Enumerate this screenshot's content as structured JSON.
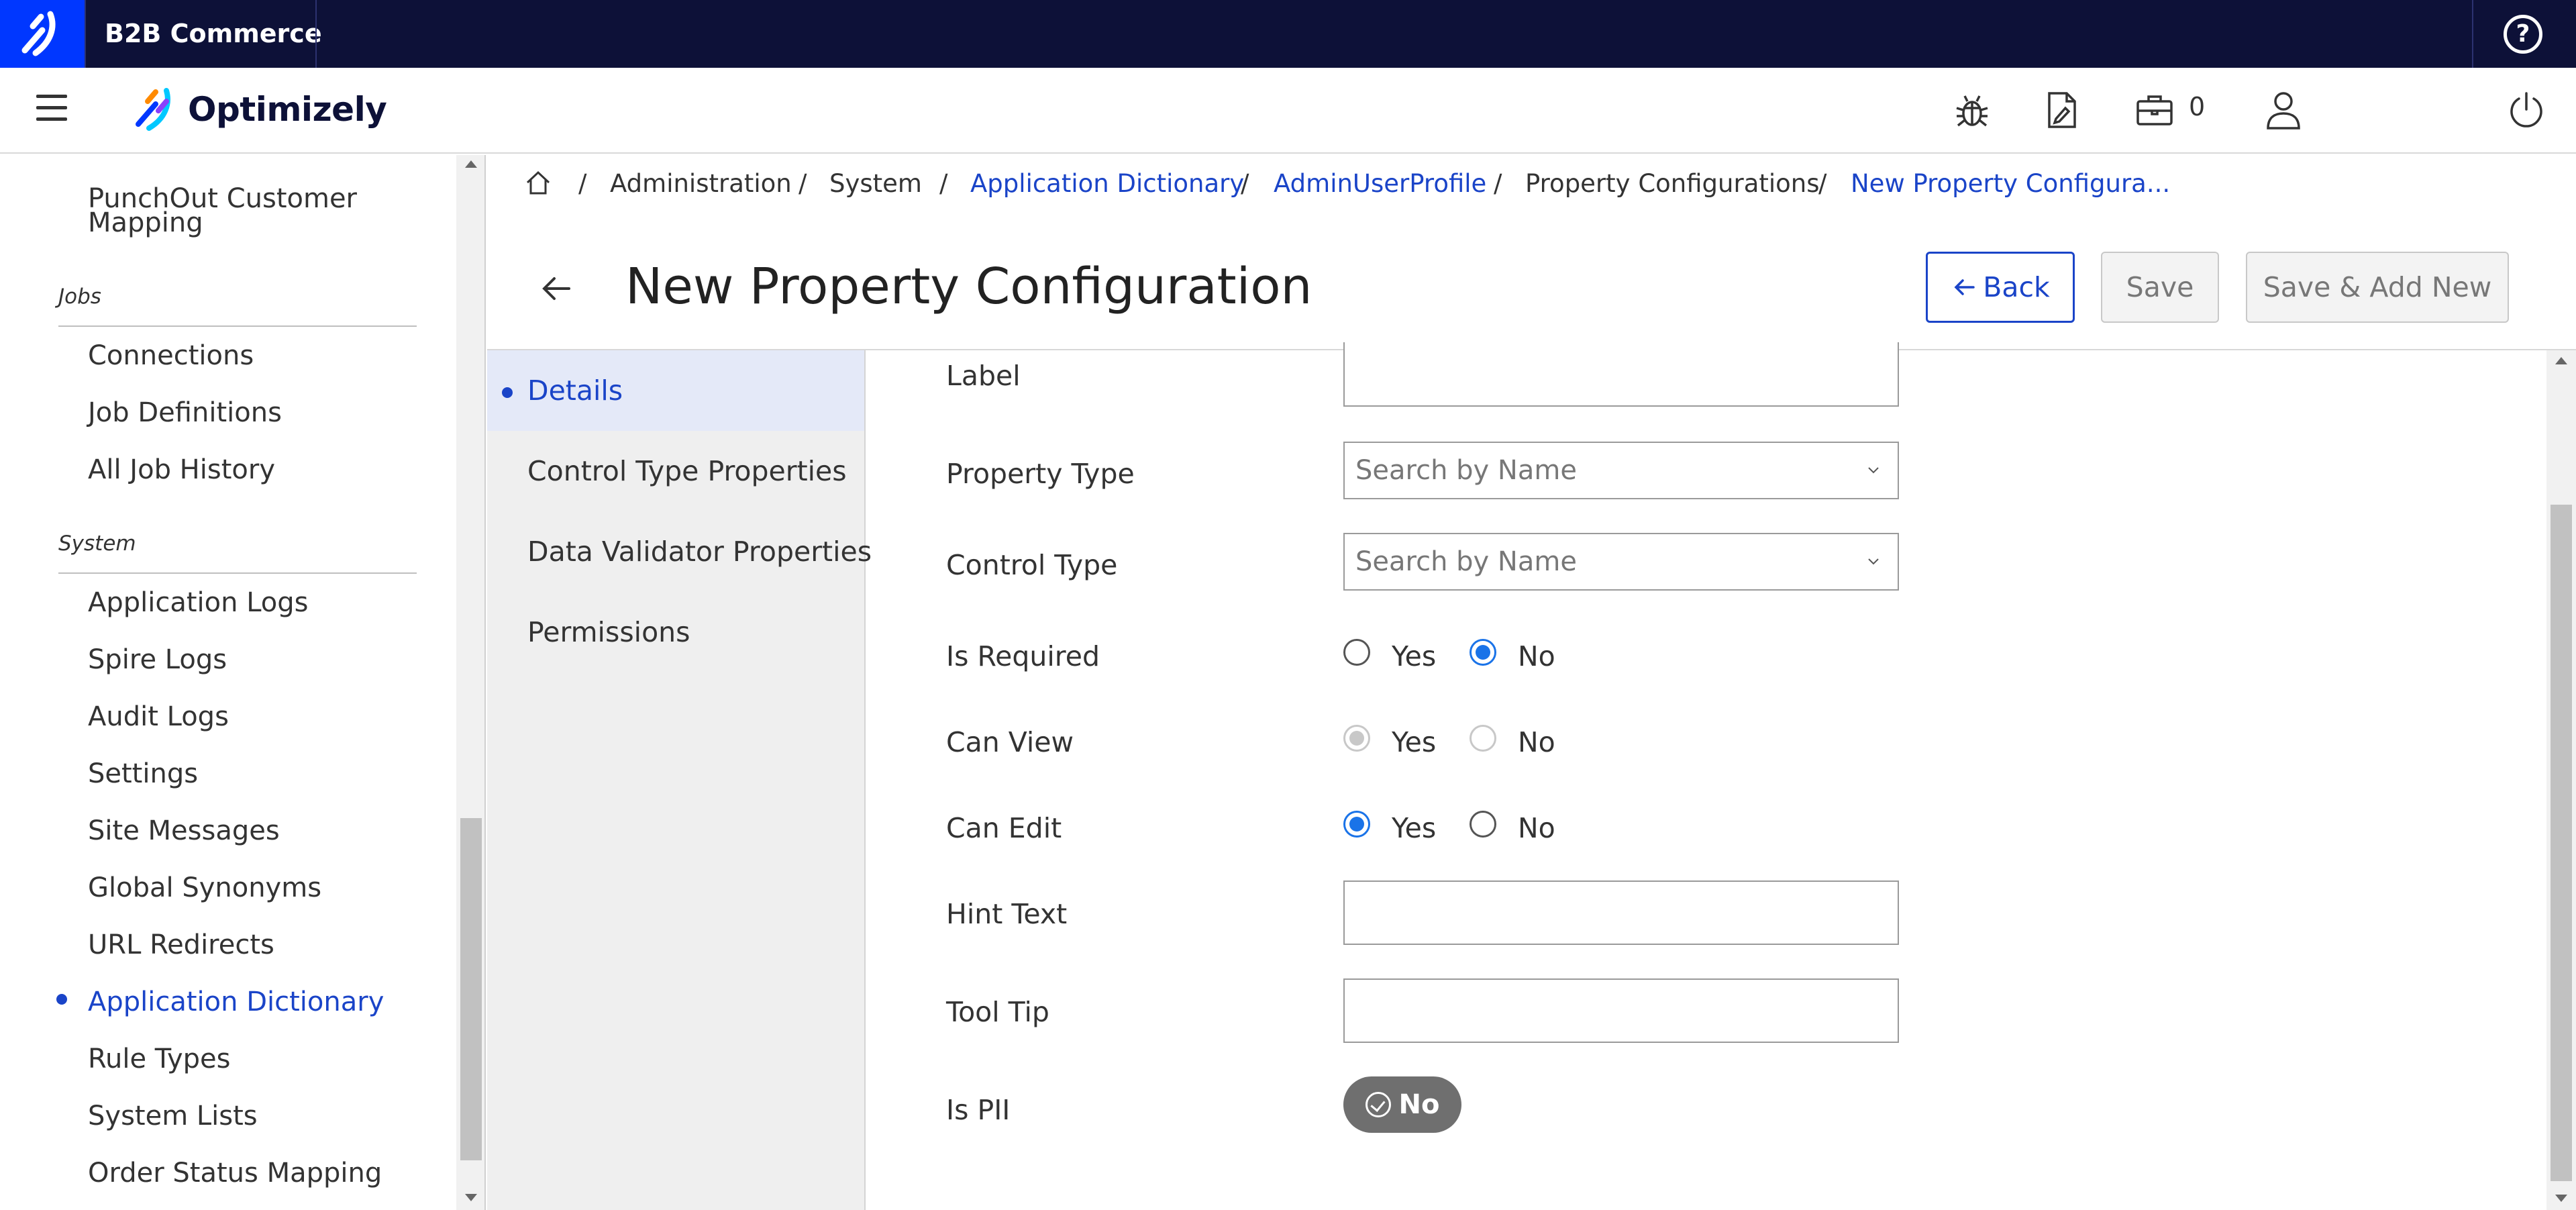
{
  "topbar": {
    "app_name": "B2B Commerce",
    "help_glyph": "?"
  },
  "header": {
    "brand": "Optimizely",
    "cart_count": "0"
  },
  "icons": [
    "menu-icon",
    "bug-icon",
    "edit-document-icon",
    "briefcase-icon",
    "user-icon",
    "power-icon",
    "home-icon",
    "back-arrow-icon",
    "chevron-down-icon",
    "check-circle-icon"
  ],
  "sidebar": {
    "punchout": "PunchOut Customer Mapping",
    "jobs_section": "Jobs",
    "jobs_items": [
      "Connections",
      "Job Definitions",
      "All Job History"
    ],
    "system_section": "System",
    "system_items": [
      "Application Logs",
      "Spire Logs",
      "Audit Logs",
      "Settings",
      "Site Messages",
      "Global Synonyms",
      "URL Redirects",
      "Application Dictionary",
      "Rule Types",
      "System Lists",
      "Order Status Mapping"
    ],
    "active_item": "Application Dictionary"
  },
  "breadcrumb": [
    "Administration",
    "System",
    "Application Dictionary",
    "AdminUserProfile",
    "Property Configurations",
    "New Property Configura..."
  ],
  "page": {
    "title": "New Property Configuration",
    "back_label": "Back",
    "save_label": "Save",
    "save_add_label": "Save & Add New"
  },
  "tabs": [
    "Details",
    "Control Type Properties",
    "Data Validator Properties",
    "Permissions"
  ],
  "form": {
    "label": {
      "label": "Label",
      "value": ""
    },
    "property_type": {
      "label": "Property Type",
      "placeholder": "Search by Name"
    },
    "control_type": {
      "label": "Control Type",
      "placeholder": "Search by Name"
    },
    "is_required": {
      "label": "Is Required",
      "yes": "Yes",
      "no": "No",
      "selected": "No"
    },
    "can_view": {
      "label": "Can View",
      "yes": "Yes",
      "no": "No",
      "selected": "Yes",
      "disabled": true
    },
    "can_edit": {
      "label": "Can Edit",
      "yes": "Yes",
      "no": "No",
      "selected": "Yes"
    },
    "hint_text": {
      "label": "Hint Text",
      "value": ""
    },
    "tool_tip": {
      "label": "Tool Tip",
      "value": ""
    },
    "is_pii": {
      "label": "Is PII",
      "value": "No"
    }
  },
  "colors": {
    "topbar": "#0d1138",
    "accent": "#1a44c8",
    "radio": "#1a73e8",
    "toggle": "#6f6f6f"
  }
}
